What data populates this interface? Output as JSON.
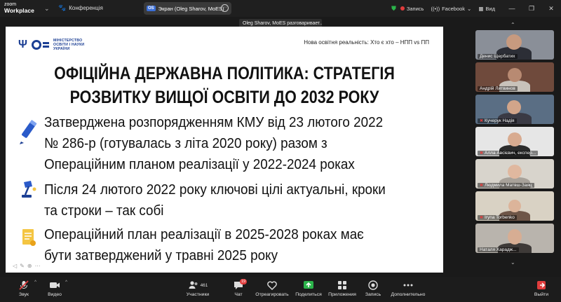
{
  "titlebar": {
    "brand_top": "zoom",
    "brand_bottom": "Workplace",
    "conference_label": "Конференція",
    "screen_tab_badge": "OS",
    "screen_tab_label": "Экран (Oleg Sharov, MoES)",
    "record_label": "Запись",
    "facebook_label": "Facebook",
    "view_label": "Вид"
  },
  "sharing_banner": "Oleg Sharov, MoES разговаривает...",
  "slide": {
    "ministry_name": [
      "МІНІСТЕРСТВО",
      "ОСВІТИ І НАУКИ",
      "УКРАЇНИ"
    ],
    "header_right": "Нова освітня реальність: Хто є хто – НПП vs ПП",
    "title_line1": "ОФІЦІЙНА ДЕРЖАВНА ПОЛІТИКА: СТРАТЕГІЯ",
    "title_line2": "РОЗВИТКУ ВИЩОЇ ОСВІТИ ДО 2032 РОКУ",
    "bullet1": [
      "Затверджена розпорядженням КМУ від 23 лютого 2022",
      "№ 286-р (готувалась з літа 2020 року) разом з",
      "Операційним планом реалізації у 2022-2024 роках"
    ],
    "bullet2": [
      "Після 24 лютого 2022 року ключові цілі актуальні, кроки",
      "та строки – так собі"
    ],
    "bullet3": [
      "Операційний план реалізації в 2025-2028 роках має",
      "бути затверджений у травні 2025 року"
    ]
  },
  "participants": [
    {
      "name": "Денис Щербатих",
      "muted": false
    },
    {
      "name": "Андрій Литвинов",
      "muted": false
    },
    {
      "name": "Кучерук Надія",
      "muted": true
    },
    {
      "name": "Алла Авсієвич, експер...",
      "muted": true
    },
    {
      "name": "Людмила Матвш-Заяц",
      "muted": true
    },
    {
      "name": "Iryna Torbenko",
      "muted": true
    },
    {
      "name": "Наталя Харадж...",
      "muted": false
    }
  ],
  "toolbar": {
    "audio": "Звук",
    "video": "Видео",
    "participants": "Участники",
    "participants_count": "461",
    "chat": "Чат",
    "chat_badge": "19",
    "react": "Отреагировать",
    "share": "Поделиться",
    "apps": "Приложения",
    "record": "Запись",
    "more": "Дополнительно",
    "leave": "Выйти"
  },
  "colors": {
    "accent_blue": "#1c3f94",
    "share_green": "#2bb34a",
    "leave_red": "#e03c3c"
  }
}
